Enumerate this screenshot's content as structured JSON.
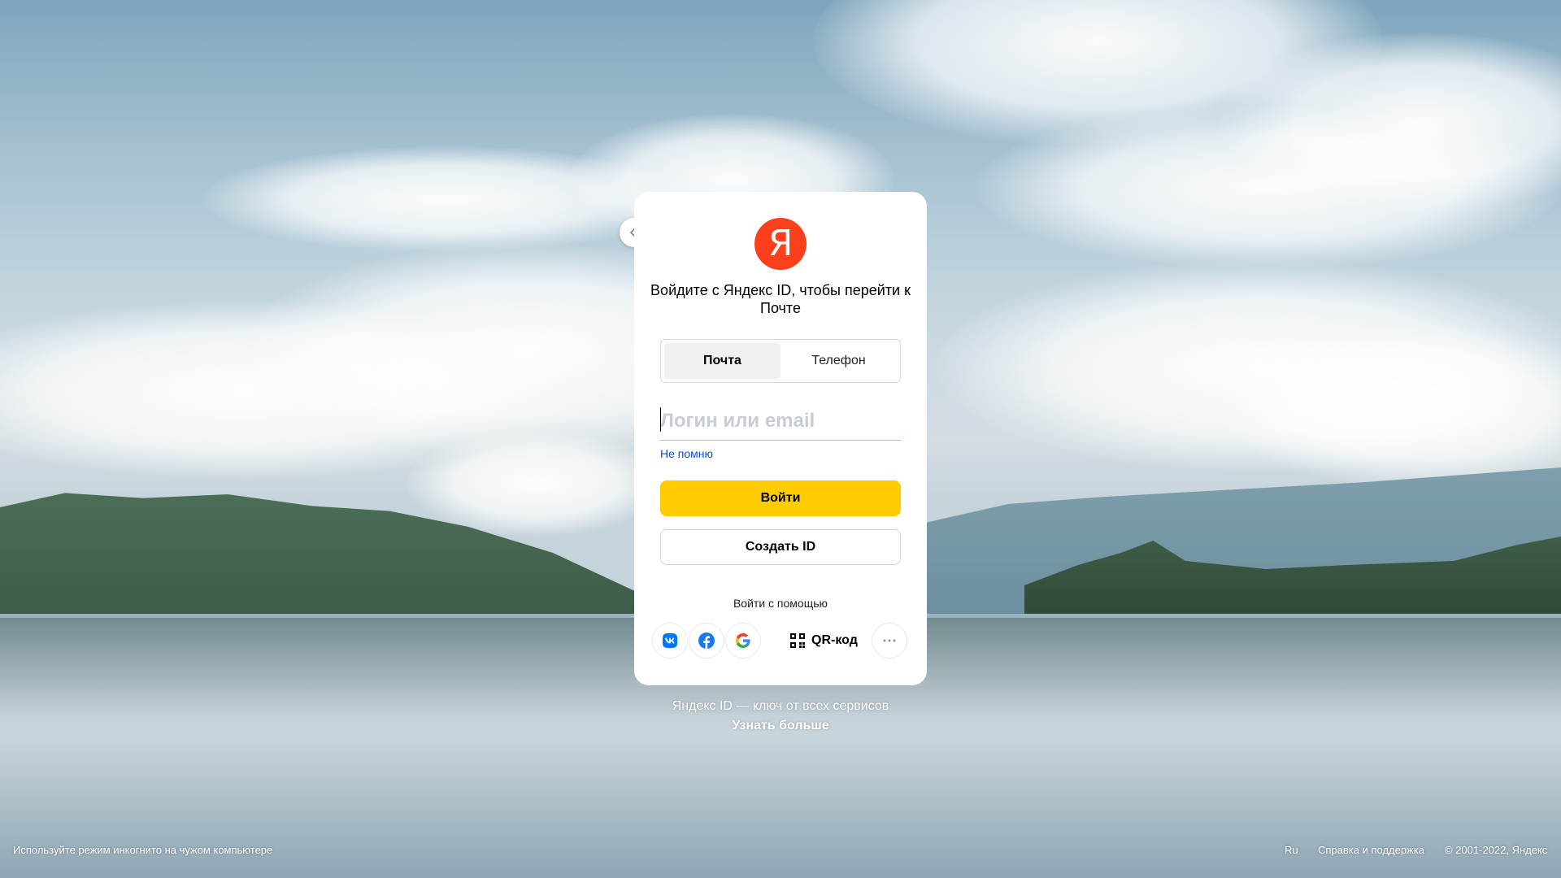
{
  "card": {
    "logo_letter": "Я",
    "title": "Войдите с Яндекс ID, чтобы перейти к Почте",
    "tabs": [
      {
        "label": "Почта",
        "active": true
      },
      {
        "label": "Телефон",
        "active": false
      }
    ],
    "login_placeholder": "Логин или email",
    "login_value": "",
    "forgot_label": "Не помню",
    "login_button": "Войти",
    "create_button": "Создать ID",
    "social_label": "Войти с помощью",
    "social": [
      {
        "name": "vk",
        "icon": "vk-icon"
      },
      {
        "name": "facebook",
        "icon": "facebook-icon"
      },
      {
        "name": "google",
        "icon": "google-icon"
      }
    ],
    "qr_label": "QR-код",
    "more_icon": "more-dots-icon"
  },
  "promo": {
    "text": "Яндекс ID — ключ от всех сервисов",
    "link": "Узнать больше"
  },
  "footer": {
    "incognito": "Используйте режим инкогнито на чужом компьютере",
    "lang": "Ru",
    "help": "Справка и поддержка",
    "copyright": "© 2001-2022, Яндекс"
  },
  "colors": {
    "accent_yellow": "#ffcc00",
    "brand_red": "#fc3f1d",
    "link_blue": "#0d4cd3"
  }
}
